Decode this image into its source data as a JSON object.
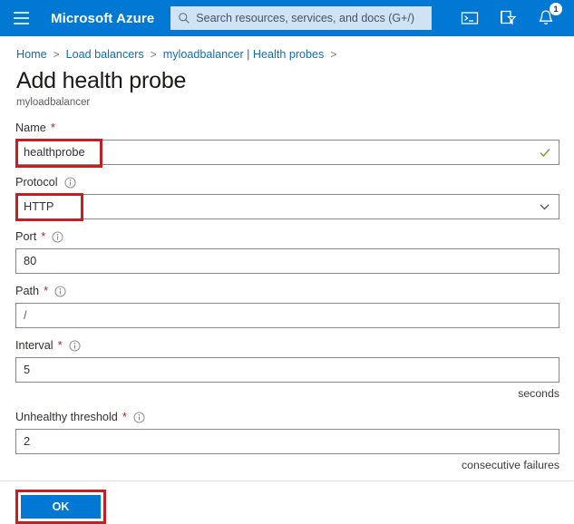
{
  "topbar": {
    "menu_label": "Global navigation menu",
    "brand": "Microsoft Azure",
    "search_placeholder": "Search resources, services, and docs (G+/)",
    "cloud_shell_label": "Cloud Shell",
    "directories_label": "Directories + subscriptions",
    "notifications_label": "Notifications",
    "notification_count": "1",
    "bg_color": "#0078d4"
  },
  "breadcrumb": {
    "items": [
      {
        "label": "Home"
      },
      {
        "label": "Load balancers"
      },
      {
        "label": "myloadbalancer | Health probes"
      }
    ],
    "separator": ">",
    "trailing_separator": ">"
  },
  "page": {
    "title": "Add health probe",
    "subtitle": "myloadbalancer"
  },
  "form": {
    "fields": [
      {
        "label": "Name",
        "required": "*",
        "has_info": false,
        "value": "healthprobe",
        "control": "text",
        "validated": true,
        "highlighted": true,
        "suffix": ""
      },
      {
        "label": "Protocol",
        "required": "",
        "has_info": true,
        "value": "HTTP",
        "control": "select",
        "validated": false,
        "highlighted": true,
        "suffix": ""
      },
      {
        "label": "Port",
        "required": "*",
        "has_info": true,
        "value": "80",
        "control": "text",
        "validated": false,
        "highlighted": false,
        "suffix": ""
      },
      {
        "label": "Path",
        "required": "*",
        "has_info": true,
        "value": "/",
        "control": "text",
        "validated": false,
        "highlighted": false,
        "suffix": ""
      },
      {
        "label": "Interval",
        "required": "*",
        "has_info": true,
        "value": "5",
        "control": "text",
        "validated": false,
        "highlighted": false,
        "suffix": "seconds"
      },
      {
        "label": "Unhealthy threshold",
        "required": "*",
        "has_info": true,
        "value": "2",
        "control": "text",
        "validated": false,
        "highlighted": false,
        "suffix": "consecutive failures"
      }
    ]
  },
  "footer": {
    "ok_label": "OK"
  },
  "colors": {
    "azure_blue": "#0078d4",
    "annotation_red": "#c32026",
    "link_blue": "#0f6cbd",
    "required_red": "#a4262c",
    "valid_check": "#8a9a3b"
  }
}
